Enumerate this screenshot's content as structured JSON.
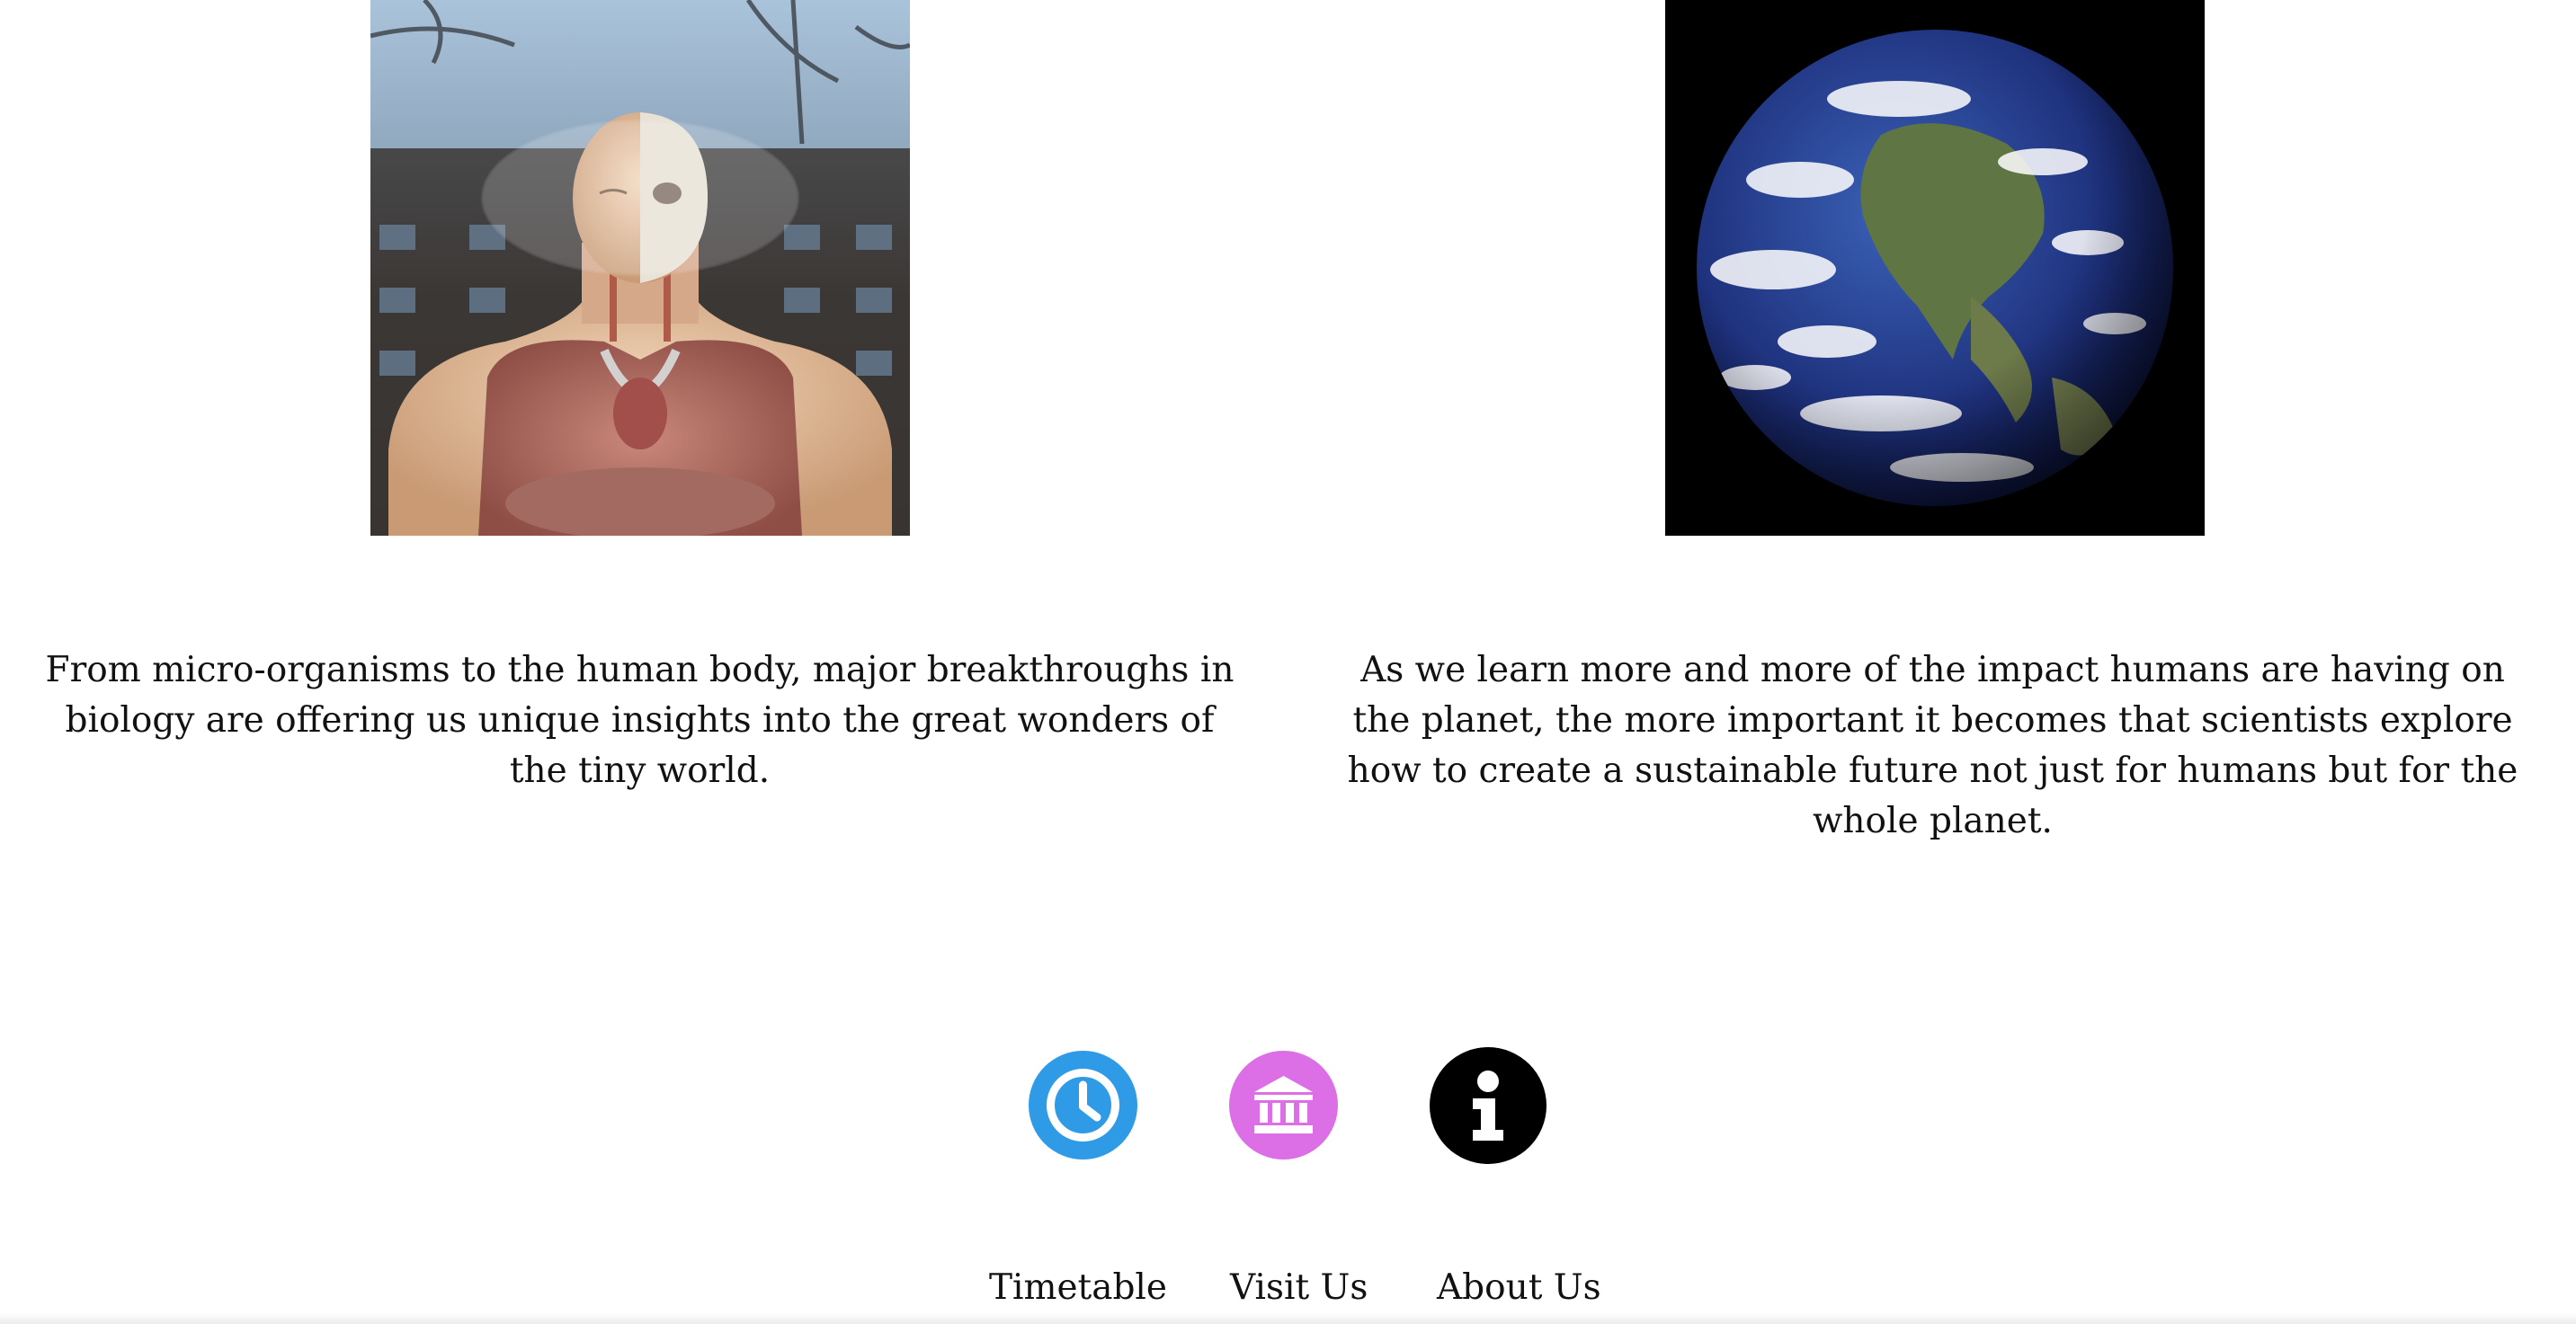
{
  "sections": [
    {
      "image_alt": "anatomical-model-image",
      "text": "From micro-organisms to the human body, major breakthroughs in biology are offering us unique insights into the great wonders of the tiny world."
    },
    {
      "image_alt": "earth-image",
      "text": "As we learn more and more of the impact humans are having on the planet, the more important it becomes that scientists explore how to create a sustainable future not just for humans but for the whole planet."
    }
  ],
  "footer": {
    "icons": [
      {
        "name": "clock-icon",
        "color": "#2f9be6"
      },
      {
        "name": "museum-icon",
        "color": "#dc6ee6"
      },
      {
        "name": "info-icon",
        "color": "#000000"
      }
    ],
    "links": [
      "Timetable",
      "Visit Us",
      "About Us"
    ]
  }
}
